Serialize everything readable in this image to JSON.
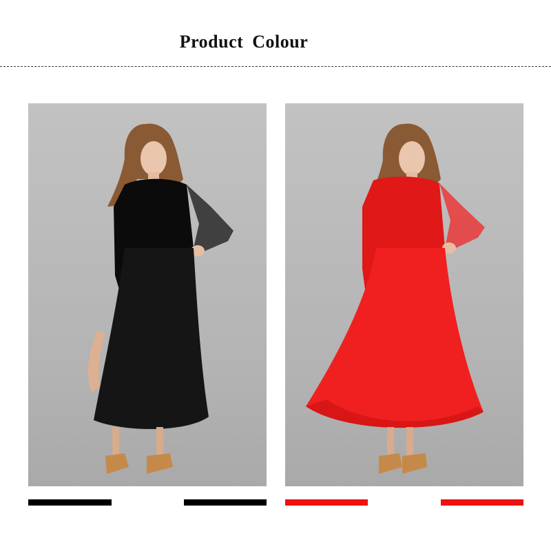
{
  "header": {
    "title": "Product  Colour"
  },
  "colors": {
    "black_swatch": "#000000",
    "red_swatch": "#ee1111",
    "backdrop": "#b9b9b9"
  },
  "products": [
    {
      "colour": "black",
      "dress_color": "#0b0b0b",
      "skirt_color": "#151515"
    },
    {
      "colour": "red",
      "dress_color": "#e01818",
      "skirt_color": "#f02020"
    }
  ]
}
